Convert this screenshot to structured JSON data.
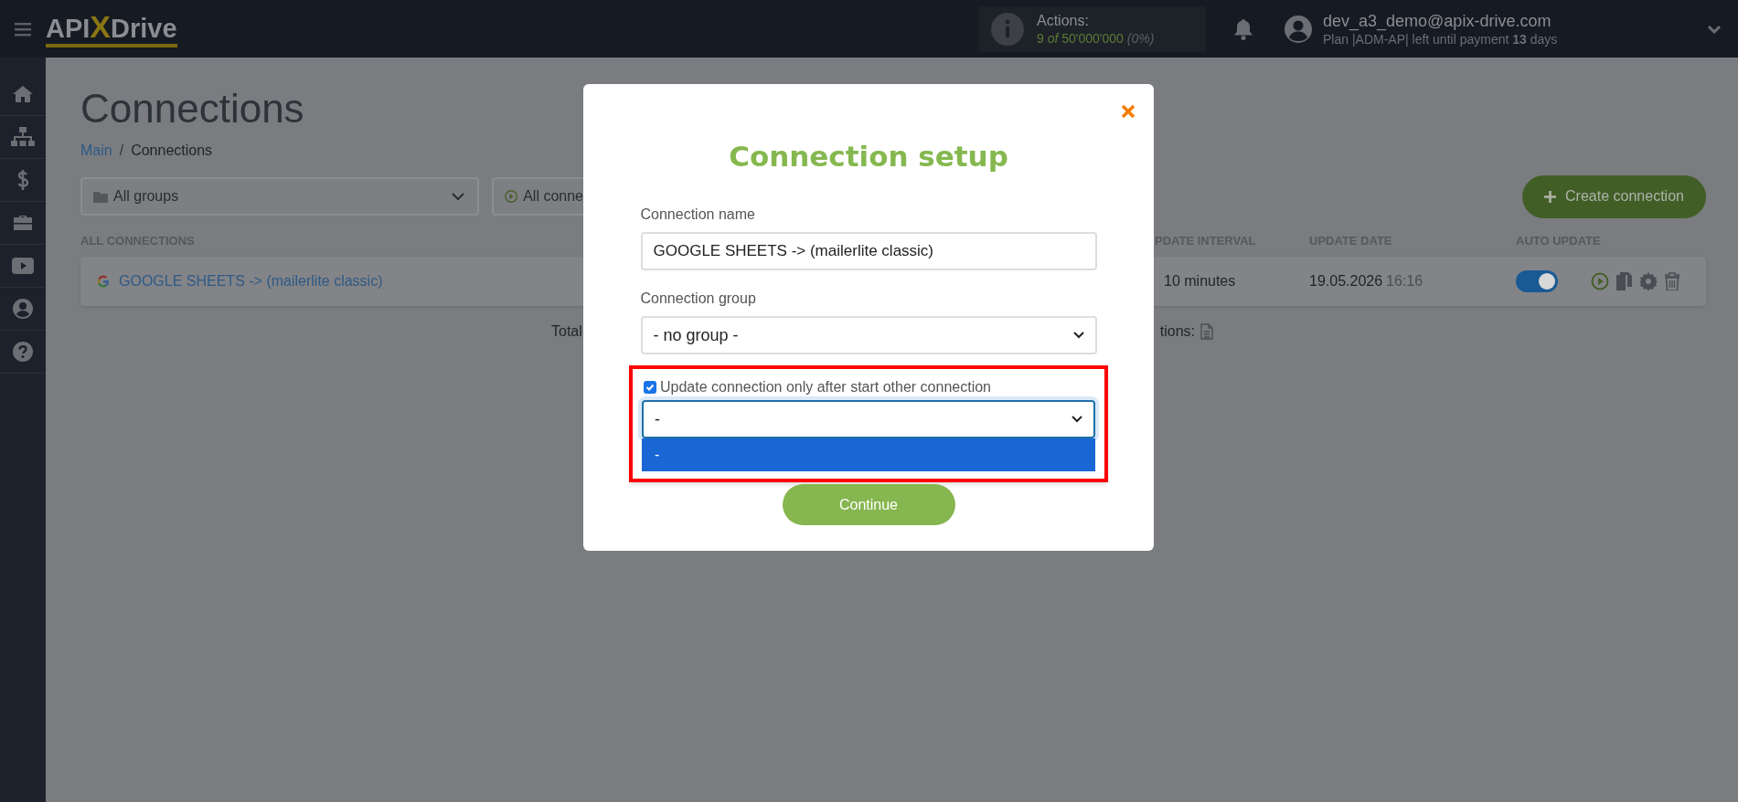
{
  "topbar": {
    "logo_parts": [
      "API",
      "X",
      "Drive"
    ],
    "actions": {
      "label": "Actions:",
      "used": "9",
      "of": "of",
      "total": "50'000'000",
      "percent": "(0%)"
    },
    "user": {
      "email": "dev_a3_demo@apix-drive.com",
      "plan": "Plan |ADM-AP| left until payment **13** days"
    }
  },
  "page": {
    "title": "Connections",
    "breadcrumb": {
      "parent": "Main",
      "separator": "/",
      "current": "Connections"
    },
    "filters": [
      {
        "kind": "groups",
        "label": "All groups"
      },
      {
        "kind": "status",
        "label": "All conne"
      }
    ],
    "create_button": "Create connection",
    "table": {
      "columns": [
        "ALL CONNECTIONS",
        "PDATE INTERVAL",
        "UPDATE DATE",
        "AUTO UPDATE"
      ],
      "rows": [
        {
          "name": "GOOGLE SHEETS -> (mailerlite classic)",
          "interval": "10 minutes",
          "date": "19.05.2026",
          "time": "16:16",
          "auto_update": true
        }
      ]
    },
    "footer": {
      "left": "Total",
      "right": "tions:"
    }
  },
  "modal": {
    "title": "Connection setup",
    "name_label": "Connection name",
    "name_value": "GOOGLE SHEETS -> (mailerlite classic)",
    "group_label": "Connection group",
    "group_value": "- no group -",
    "dependency": {
      "highlighted": true,
      "checkbox_label": "Update connection only after start other connection",
      "checked": true,
      "value": "-",
      "expanded": true,
      "options": [
        {
          "label": "-",
          "selected": true
        }
      ]
    },
    "continue_button": "Continue"
  }
}
